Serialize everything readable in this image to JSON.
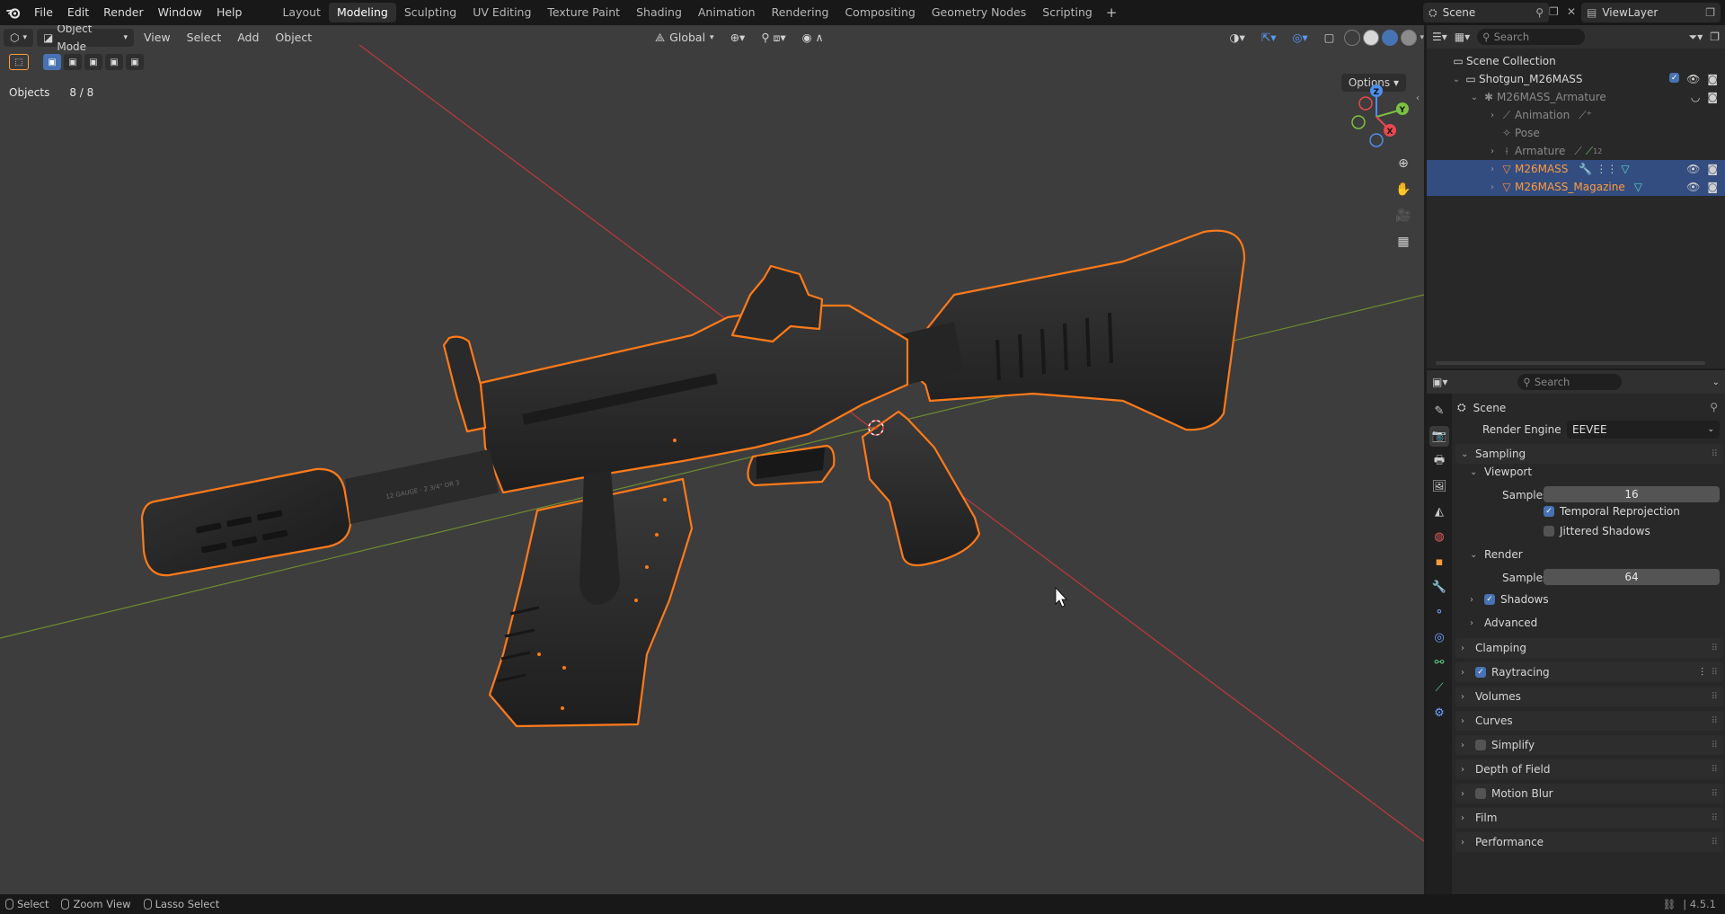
{
  "menu": {
    "items": [
      "File",
      "Edit",
      "Render",
      "Window",
      "Help"
    ]
  },
  "workspaces": {
    "tabs": [
      "Layout",
      "Modeling",
      "Sculpting",
      "UV Editing",
      "Texture Paint",
      "Shading",
      "Animation",
      "Rendering",
      "Compositing",
      "Geometry Nodes",
      "Scripting"
    ],
    "active": "Modeling",
    "add": "+"
  },
  "topright": {
    "scene_label": "Scene",
    "viewlayer_label": "ViewLayer"
  },
  "viewport": {
    "mode": "Object Mode",
    "menu": [
      "View",
      "Select",
      "Add",
      "Object"
    ],
    "orientation": "Global",
    "options": "Options",
    "objects_label": "Objects",
    "objects_count": "8 / 8",
    "gizmo": {
      "z": "Z",
      "y": "Y",
      "x": "X"
    },
    "engraving": "12 GAUGE · 2 3/4\" OR 3"
  },
  "outliner": {
    "search_placeholder": "Search",
    "rows": [
      {
        "label": "Scene Collection"
      },
      {
        "label": "Shotgun_M26MASS"
      },
      {
        "label": "M26MASS_Armature"
      },
      {
        "label": "Animation"
      },
      {
        "label": "Pose"
      },
      {
        "label": "Armature",
        "badge": "12"
      },
      {
        "label": "M26MASS"
      },
      {
        "label": "M26MASS_Magazine"
      }
    ]
  },
  "properties": {
    "search_placeholder": "Search",
    "context": "Scene",
    "render_engine_label": "Render Engine",
    "render_engine": "EEVEE",
    "sampling": "Sampling",
    "viewport_sub": "Viewport",
    "samples_label": "Samples",
    "viewport_samples": "16",
    "temporal_reprojection": "Temporal Reprojection",
    "jittered_shadows": "Jittered Shadows",
    "render_sub": "Render",
    "render_samples": "64",
    "shadows": "Shadows",
    "advanced": "Advanced",
    "panels": [
      "Clamping",
      "Raytracing",
      "Volumes",
      "Curves",
      "Simplify",
      "Depth of Field",
      "Motion Blur",
      "Film",
      "Performance"
    ]
  },
  "statusbar": {
    "select": "Select",
    "zoom": "Zoom View",
    "lasso": "Lasso Select",
    "version": "4.5.1"
  },
  "colors": {
    "selection_outline": "#ff7a1a",
    "active_tab": "#4772b3",
    "viewport_bg": "#3d3d3d"
  }
}
